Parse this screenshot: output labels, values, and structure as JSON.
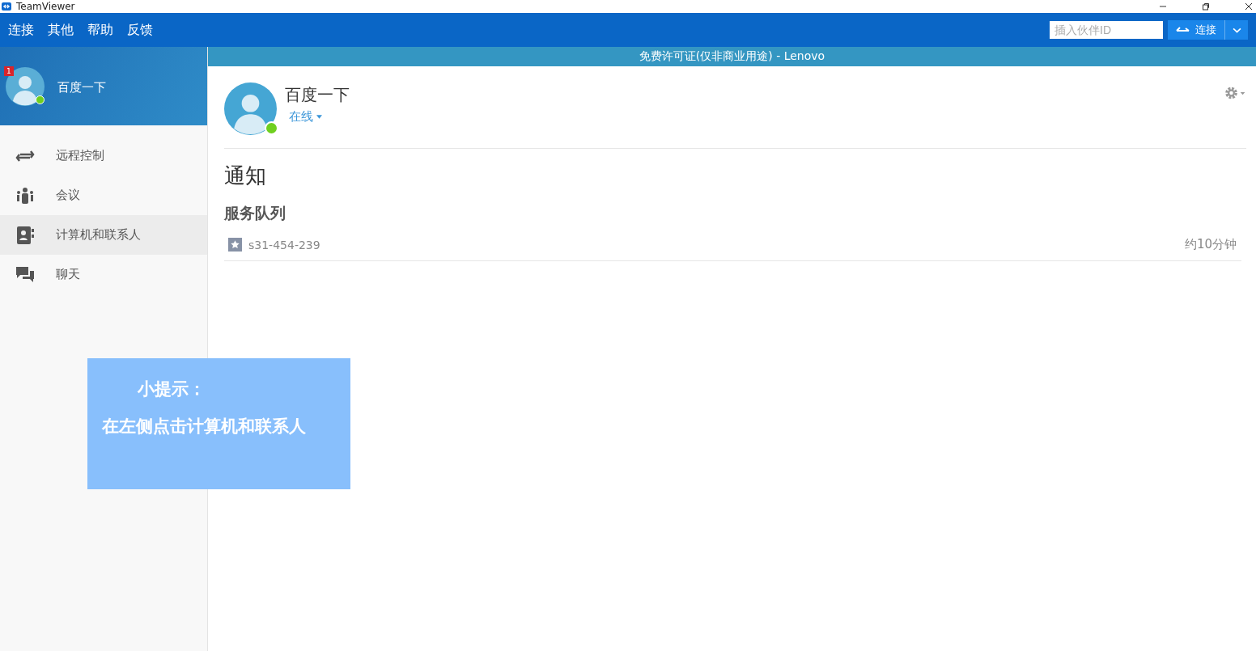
{
  "window": {
    "title": "TeamViewer"
  },
  "menu": [
    {
      "label": "连接"
    },
    {
      "label": "其他"
    },
    {
      "label": "帮助"
    },
    {
      "label": "反馈"
    }
  ],
  "partner_id": {
    "placeholder": "插入伙伴ID"
  },
  "connect_button": {
    "label": "连接"
  },
  "license_bar": "免费许可证(仅非商业用途) - Lenovo",
  "profile": {
    "name": "百度一下",
    "badge": "1",
    "online": true
  },
  "sidebar": {
    "items": [
      {
        "kind": "remote",
        "label": "远程控制",
        "selected": false
      },
      {
        "kind": "meeting",
        "label": "会议",
        "selected": false
      },
      {
        "kind": "contacts",
        "label": "计算机和联系人",
        "selected": true
      },
      {
        "kind": "chat",
        "label": "聊天",
        "selected": false
      }
    ]
  },
  "account": {
    "name": "百度一下",
    "status": "在线",
    "online": true
  },
  "notifications": {
    "title": "通知",
    "section": "服务队列",
    "items": [
      {
        "id": "s31-454-239",
        "time": "约10分钟"
      }
    ]
  },
  "tip": {
    "title": "小提示：",
    "text": "在左侧点击计算机和联系人"
  }
}
